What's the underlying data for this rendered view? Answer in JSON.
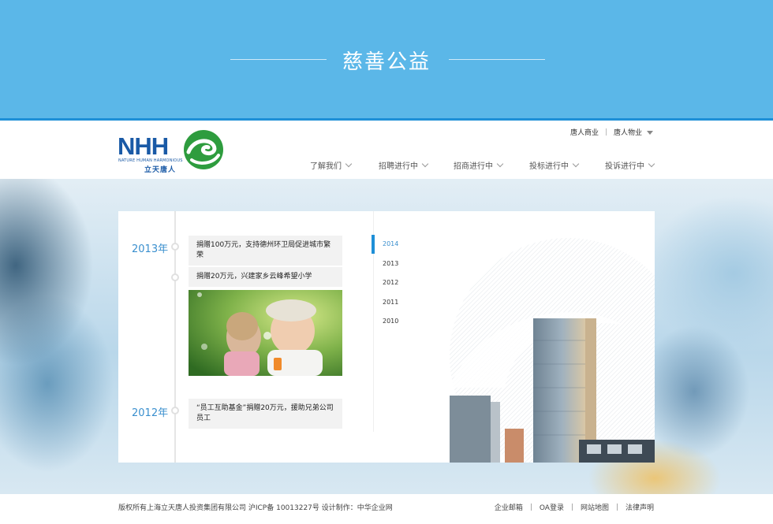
{
  "banner": {
    "title": "慈善公益"
  },
  "logo": {
    "brand": "NHH",
    "tagline": "NATURE HUMAN HARMONIOUS",
    "cn_name": "立天唐人"
  },
  "toplinks": {
    "link1": "唐人商业",
    "link2": "唐人物业"
  },
  "nav": {
    "items": [
      {
        "label": "了解我们"
      },
      {
        "label": "招聘进行中"
      },
      {
        "label": "招商进行中"
      },
      {
        "label": "投标进行中"
      },
      {
        "label": "投诉进行中"
      }
    ]
  },
  "timeline": {
    "year_2013": "2013年",
    "year_2012": "2012年",
    "events": [
      {
        "text": "捐赠100万元，支持德州环卫局促进城市繁荣"
      },
      {
        "text": "捐赠20万元，兴建家乡云峰希望小学"
      },
      {
        "text": "“员工互助基金”捐赠20万元，援助兄弟公司员工"
      }
    ]
  },
  "year_list": [
    "2014",
    "2013",
    "2012",
    "2011",
    "2010"
  ],
  "footer": {
    "copyright": "版权所有上海立天唐人投资集团有限公司   沪ICP备 10013227号  设计制作：中华企业网",
    "links": [
      "企业邮箱",
      "OA登录",
      "网站地图",
      "法律声明"
    ]
  },
  "colors": {
    "banner": "#5bb7e8",
    "accent": "#1e8fd7",
    "year_text": "#3a8fce"
  }
}
